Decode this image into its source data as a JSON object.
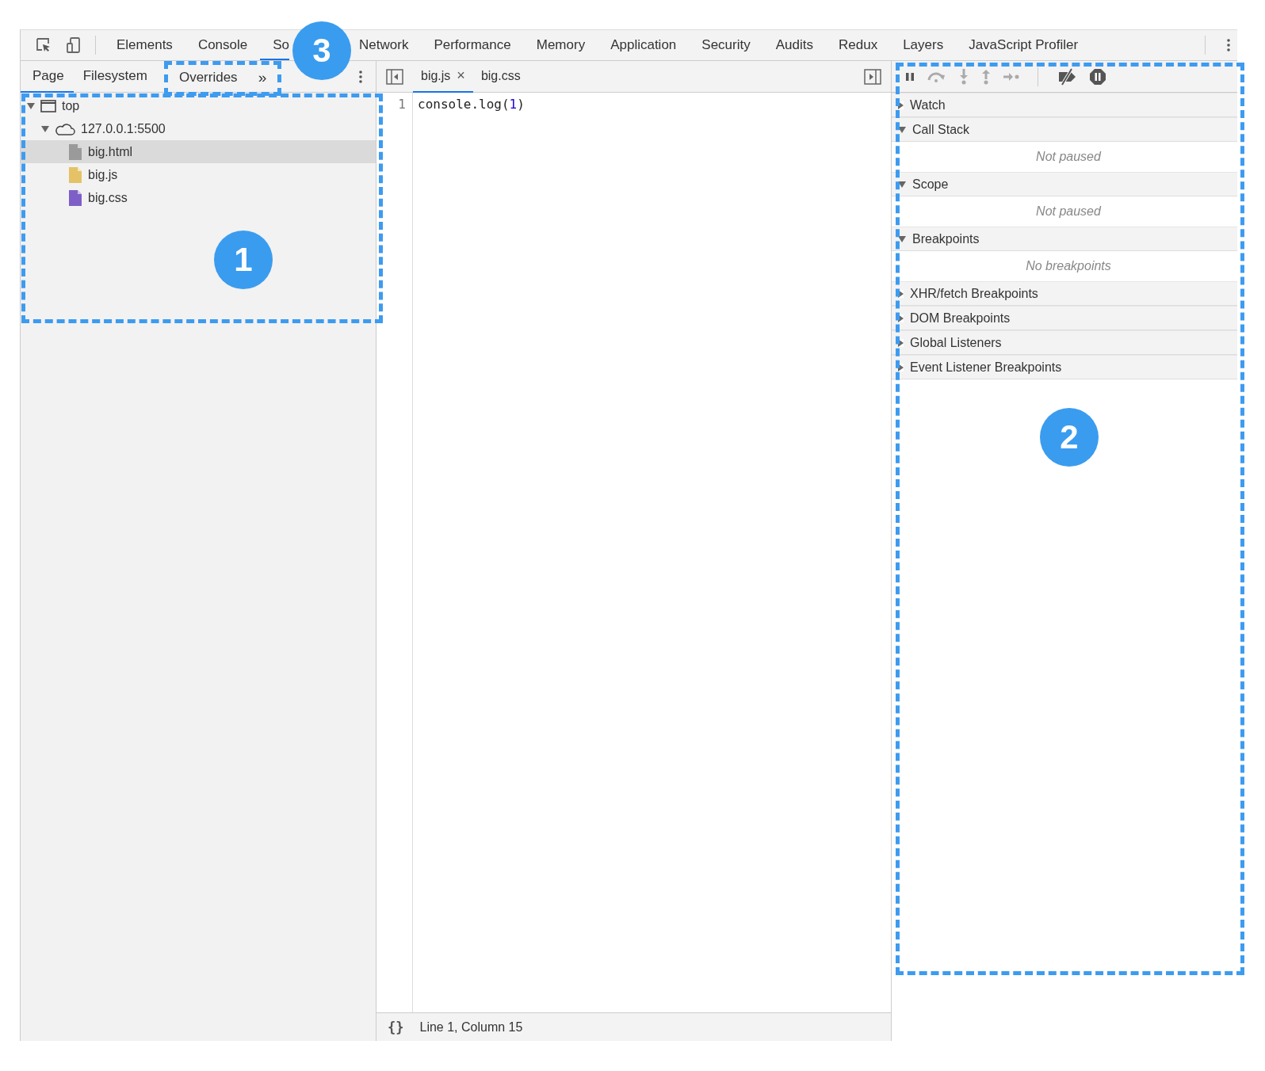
{
  "main_tabs": [
    {
      "label": "Elements",
      "selected": false
    },
    {
      "label": "Console",
      "selected": false
    },
    {
      "label": "So",
      "selected": true
    },
    {
      "label": "Network",
      "selected": false
    },
    {
      "label": "Performance",
      "selected": false
    },
    {
      "label": "Memory",
      "selected": false
    },
    {
      "label": "Application",
      "selected": false
    },
    {
      "label": "Security",
      "selected": false
    },
    {
      "label": "Audits",
      "selected": false
    },
    {
      "label": "Redux",
      "selected": false
    },
    {
      "label": "Layers",
      "selected": false
    },
    {
      "label": "JavaScript Profiler",
      "selected": false
    }
  ],
  "navigator": {
    "tabs": [
      {
        "label": "Page",
        "selected": true
      },
      {
        "label": "Filesystem",
        "selected": false
      },
      {
        "label": "Overrides",
        "selected": false
      }
    ],
    "more": "»",
    "tree": [
      {
        "label": "top",
        "kind": "frame",
        "expanded": true,
        "selected": false,
        "children": [
          {
            "label": "127.0.0.1:5500",
            "kind": "domain",
            "expanded": true,
            "selected": false,
            "children": [
              {
                "label": "big.html",
                "kind": "html",
                "selected": true
              },
              {
                "label": "big.js",
                "kind": "js",
                "selected": false
              },
              {
                "label": "big.css",
                "kind": "css",
                "selected": false
              }
            ]
          }
        ]
      }
    ]
  },
  "editor": {
    "tabs": [
      {
        "label": "big.js",
        "selected": true,
        "close": "×"
      },
      {
        "label": "big.css",
        "selected": false
      }
    ],
    "lines": [
      {
        "number": "1",
        "tokens": [
          {
            "text": "console.log(",
            "kind": "plain"
          },
          {
            "text": "1",
            "kind": "number"
          },
          {
            "text": ")",
            "kind": "plain"
          }
        ]
      }
    ],
    "status": {
      "format": "{}",
      "position": "Line 1, Column 15"
    }
  },
  "debugger": {
    "sections": [
      {
        "title": "Watch",
        "expanded": false
      },
      {
        "title": "Call Stack",
        "expanded": true,
        "body": "Not paused"
      },
      {
        "title": "Scope",
        "expanded": true,
        "body": "Not paused"
      },
      {
        "title": "Breakpoints",
        "expanded": true,
        "body": "No breakpoints"
      },
      {
        "title": "XHR/fetch Breakpoints",
        "expanded": false
      },
      {
        "title": "DOM Breakpoints",
        "expanded": false
      },
      {
        "title": "Global Listeners",
        "expanded": false
      },
      {
        "title": "Event Listener Breakpoints",
        "expanded": false
      }
    ]
  },
  "annotations": [
    {
      "label": "1"
    },
    {
      "label": "2"
    },
    {
      "label": "3"
    }
  ]
}
